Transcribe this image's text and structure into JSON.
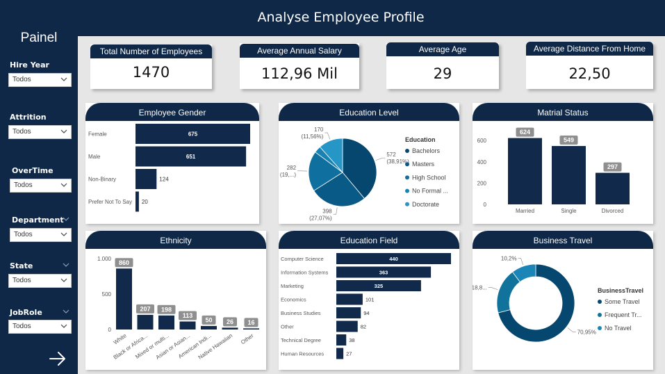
{
  "header": {
    "title": "Analyse Employee Profile"
  },
  "sidebar": {
    "title": "Painel",
    "filters": [
      {
        "label": "Hire Year",
        "value": "Todos"
      },
      {
        "label": "Attrition",
        "value": "Todos"
      },
      {
        "label": "OverTime",
        "value": "Todos"
      },
      {
        "label": "Department",
        "value": "Todos"
      },
      {
        "label": "State",
        "value": "Todos"
      },
      {
        "label": "JobRole",
        "value": "Todos"
      }
    ]
  },
  "kpis": [
    {
      "label": "Total Number of Employees",
      "value": "1470"
    },
    {
      "label": "Average Annual Salary",
      "value": "112,96 Mil"
    },
    {
      "label": "Average Age",
      "value": "29"
    },
    {
      "label": "Average Distance From Home",
      "value": "22,50"
    }
  ],
  "colors": {
    "navy": "#0f2847",
    "bar": "#11294a",
    "pie": [
      "#06476f",
      "#0a5a88",
      "#0f6f9f",
      "#1883b3",
      "#2596c6"
    ],
    "travel": [
      "#06476f",
      "#11729b",
      "#1b85b8"
    ],
    "label_box": "#8f8f8f"
  },
  "cards": {
    "gender": "Employee Gender",
    "education_level": "Education Level",
    "marital": "Matrial Status",
    "ethnicity": "Ethnicity",
    "education_field": "Education Field",
    "business_travel": "Business Travel"
  },
  "chart_data": [
    {
      "id": "gender",
      "type": "bar",
      "orientation": "horizontal",
      "title": "Employee Gender",
      "categories": [
        "Female",
        "Male",
        "Non-Binary",
        "Prefer Not To Say"
      ],
      "values": [
        675,
        651,
        124,
        20
      ]
    },
    {
      "id": "education_level",
      "type": "pie",
      "title": "Education Level",
      "legend_title": "Education",
      "labels": [
        "Bachelors",
        "Masters",
        "High School",
        "No Formal ...",
        "Doctorate"
      ],
      "values": [
        572,
        398,
        282,
        48,
        170
      ],
      "data_labels": [
        [
          "572",
          "(38,91%)"
        ],
        [
          "398",
          "(27,07%)"
        ],
        [
          "282",
          "(19,...)"
        ],
        null,
        [
          "170",
          "(11,56%)"
        ]
      ],
      "legend": "right"
    },
    {
      "id": "marital",
      "type": "bar",
      "title": "Matrial Status",
      "categories": [
        "Married",
        "Single",
        "Divorced"
      ],
      "values": [
        624,
        549,
        297
      ],
      "yticks": [
        "0",
        "200",
        "400",
        "600"
      ],
      "ylim": [
        0,
        680
      ]
    },
    {
      "id": "ethnicity",
      "type": "bar",
      "title": "Ethnicity",
      "categories": [
        "White",
        "Black or Africa...",
        "Mixed or multi...",
        "Asian or Asian...",
        "American Indi...",
        "Native Hawaiian",
        "Other"
      ],
      "values": [
        860,
        207,
        198,
        113,
        50,
        26,
        16
      ],
      "yticks": [
        "0",
        "500",
        "1.000"
      ],
      "ylim": [
        0,
        1000
      ]
    },
    {
      "id": "education_field",
      "type": "bar",
      "orientation": "horizontal",
      "title": "Education Field",
      "categories": [
        "Computer Science",
        "Information Systems",
        "Marketing",
        "Economics",
        "Business Studies",
        "Other",
        "Technical Degree",
        "Human Resources"
      ],
      "values": [
        440,
        363,
        325,
        101,
        94,
        82,
        38,
        27
      ]
    },
    {
      "id": "business_travel",
      "type": "pie",
      "donut": true,
      "title": "Business Travel",
      "legend_title": "BusinessTravel",
      "labels": [
        "Some Travel",
        "Frequent Tr...",
        "No Travel"
      ],
      "values": [
        70.95,
        18.8,
        10.2
      ],
      "data_labels": [
        "70,95%",
        "18,8...",
        "10,2%"
      ],
      "legend": "right"
    }
  ]
}
